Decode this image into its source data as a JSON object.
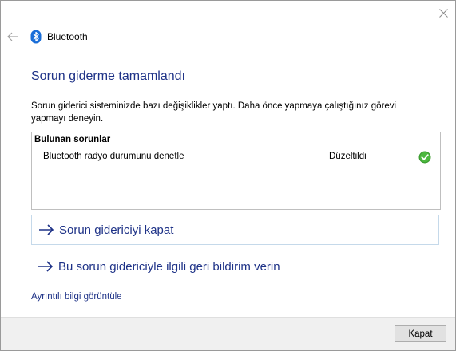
{
  "window": {
    "title": "Bluetooth",
    "icon": "bluetooth-icon",
    "accent_color": "#1e3287"
  },
  "main": {
    "heading": "Sorun giderme tamamlandı",
    "description": "Sorun giderici sisteminizde bazı değişiklikler yaptı. Daha önce yapmaya çalıştığınız görevi yapmayı deneyin.",
    "problems": {
      "header": "Bulunan sorunlar",
      "rows": [
        {
          "name": "Bluetooth radyo durumunu denetle",
          "status": "Düzeltildi",
          "status_icon": "check-circle-icon",
          "status_color": "#3a9a2e"
        }
      ]
    },
    "actions": [
      {
        "label": "Sorun gidericiyi kapat",
        "icon": "arrow-right-icon"
      },
      {
        "label": "Bu sorun gidericiyle ilgili geri bildirim verin",
        "icon": "arrow-right-icon"
      }
    ],
    "details_link": "Ayrıntılı bilgi görüntüle"
  },
  "footer": {
    "close_label": "Kapat"
  }
}
